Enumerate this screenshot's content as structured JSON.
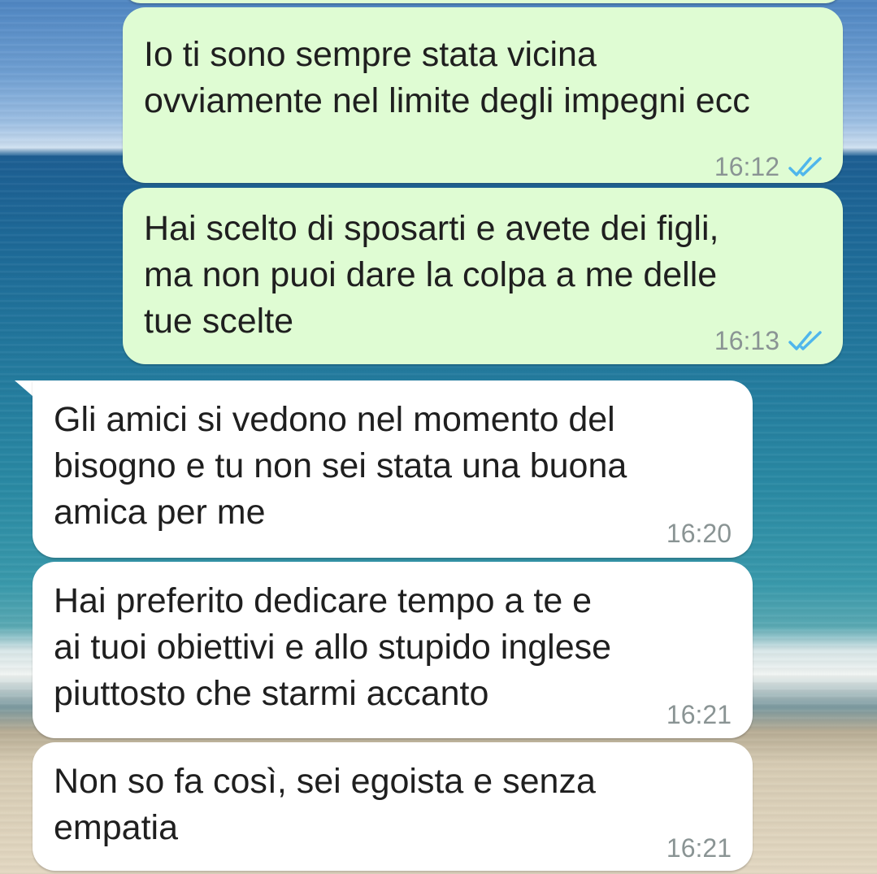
{
  "conversation": {
    "messages": [
      {
        "direction": "outgoing",
        "text": "Io ti sono sempre stata vicina\novviamente nel limite degli impegni ecc",
        "time": "16:12",
        "status_icon": "double-check-read-icon"
      },
      {
        "direction": "outgoing",
        "text": "Hai scelto di sposarti e avete dei figli,\nma non puoi dare la colpa a me delle\ntue scelte",
        "time": "16:13",
        "status_icon": "double-check-read-icon"
      },
      {
        "direction": "incoming",
        "text": "Gli amici si vedono nel momento del\nbisogno e tu non sei stata una buona\namica per me",
        "time": "16:20"
      },
      {
        "direction": "incoming",
        "text": "Hai preferito dedicare tempo a te e\nai tuoi obiettivi e allo stupido inglese\npiuttosto che starmi accanto",
        "time": "16:21"
      },
      {
        "direction": "incoming",
        "text": "Non so fa così, sei egoista e senza\nempatia",
        "time": "16:21"
      }
    ]
  },
  "colors": {
    "outgoing_bubble": "#dffcd3",
    "incoming_bubble": "#ffffff",
    "read_tick": "#4fb6ec",
    "timestamp": "#8a9494"
  },
  "wallpaper": "beach-sea-photo"
}
